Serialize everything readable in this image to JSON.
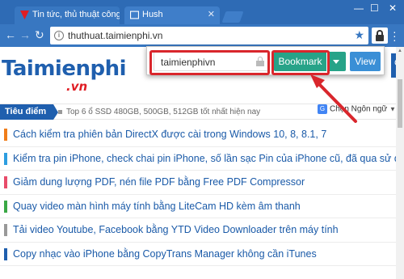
{
  "browser": {
    "tabs": [
      {
        "title": "Tin tức, thủ thuật công nghệ",
        "active": true
      },
      {
        "title": "Hush",
        "active": false
      }
    ],
    "window_controls": {
      "minimize": "—",
      "maximize": "☐",
      "close": "✕"
    },
    "address_bar": {
      "url": "thuthuat.taimienphi.vn"
    },
    "accent_color": "#3877c1"
  },
  "popup": {
    "password_value": "taimienphivn",
    "bookmark_label": "Bookmark",
    "view_label": "View",
    "bookmark_color": "#27a388",
    "view_color": "#3a8fd6"
  },
  "page": {
    "logo": {
      "main": "Taimienphi",
      "suffix": ".vn"
    },
    "right_strip_text": "C",
    "language_label": "Chọn Ngôn ngữ",
    "focus": {
      "label": "Tiêu điểm",
      "headline": "Top 6 ổ SSD 480GB, 500GB, 512GB tốt nhất hiện nay"
    },
    "articles": [
      {
        "title": "Cách kiểm tra phiên bản DirectX được cài trong Windows 10, 8, 8.1, 7",
        "color": "#f07d1a"
      },
      {
        "title": "Kiểm tra pin iPhone, check chai pin iPhone, số lần sạc Pin của iPhone cũ, đã qua sử dụng",
        "color": "#2d9ee0"
      },
      {
        "title": "Giảm dung lượng PDF, nén file PDF bằng Free PDF Compressor",
        "color": "#e84c6a"
      },
      {
        "title": "Quay video màn hình máy tính bằng LiteCam HD kèm âm thanh",
        "color": "#3aa845"
      },
      {
        "title": "Tải video Youtube, Facebook bằng YTD Video Downloader trên máy tính",
        "color": "#999999"
      },
      {
        "title": "Copy nhạc vào iPhone bằng CopyTrans Manager không cần iTunes",
        "color": "#1f5fae"
      }
    ]
  },
  "annotation_color": "#d9262c"
}
